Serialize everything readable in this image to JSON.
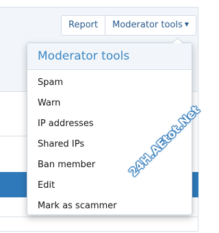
{
  "header_buttons": {
    "report_label": "Report",
    "moderator_tools_label": "Moderator tools"
  },
  "menu": {
    "title": "Moderator tools",
    "items": [
      {
        "label": "Spam"
      },
      {
        "label": "Warn"
      },
      {
        "label": "IP addresses"
      },
      {
        "label": "Shared IPs"
      },
      {
        "label": "Ban member"
      },
      {
        "label": "Edit"
      },
      {
        "label": "Mark as scammer"
      }
    ]
  },
  "watermark": {
    "text": "24H.AEtot.Net"
  },
  "colors": {
    "accent": "#3b86c3",
    "link": "#2a5a8c",
    "bar": "#2f79ba"
  },
  "icons": {
    "dropdown": "caret-down-icon"
  }
}
